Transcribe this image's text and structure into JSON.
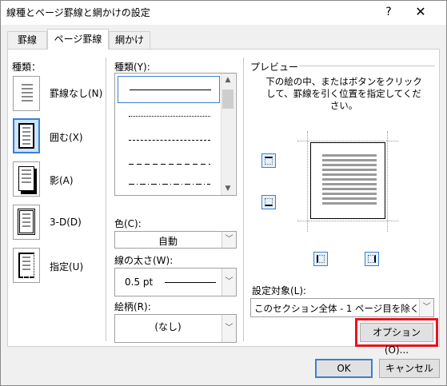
{
  "window": {
    "title": "線種とページ罫線と網かけの設定",
    "help": "?",
    "close": "✕"
  },
  "tabs": [
    {
      "label": "罫線"
    },
    {
      "label": "ページ罫線"
    },
    {
      "label": "網かけ"
    }
  ],
  "settings": {
    "label": "種類：",
    "items": [
      {
        "label": "罫線なし(N)",
        "icon": "border-none-icon"
      },
      {
        "label": "囲む(X)",
        "icon": "border-box-icon",
        "selected": true
      },
      {
        "label": "影(A)",
        "icon": "border-shadow-icon"
      },
      {
        "label": "3-D(D)",
        "icon": "border-3d-icon"
      },
      {
        "label": "指定(U)",
        "icon": "border-custom-icon"
      }
    ]
  },
  "style": {
    "label": "種類(Y):",
    "line_styles": [
      "solid",
      "dotted",
      "dashed-small",
      "dashed",
      "dash-dot"
    ]
  },
  "color": {
    "label": "色(C):",
    "value": "自動"
  },
  "width": {
    "label": "線の太さ(W):",
    "value": "0.5 pt"
  },
  "art": {
    "label": "絵柄(R):",
    "value": "(なし)"
  },
  "preview": {
    "label": "プレビュー",
    "instruction": "下の絵の中、またはボタンをクリックして、罫線を引く位置を指定してください。"
  },
  "apply_to": {
    "label": "設定対象(L):",
    "value": "このセクション全体 - 1 ページ目を除く"
  },
  "buttons": {
    "options": "オプション(O)...",
    "ok": "OK",
    "cancel": "キャンセル"
  },
  "colors": {
    "accent": "#3c7fd0",
    "highlight": "#e8141e"
  }
}
